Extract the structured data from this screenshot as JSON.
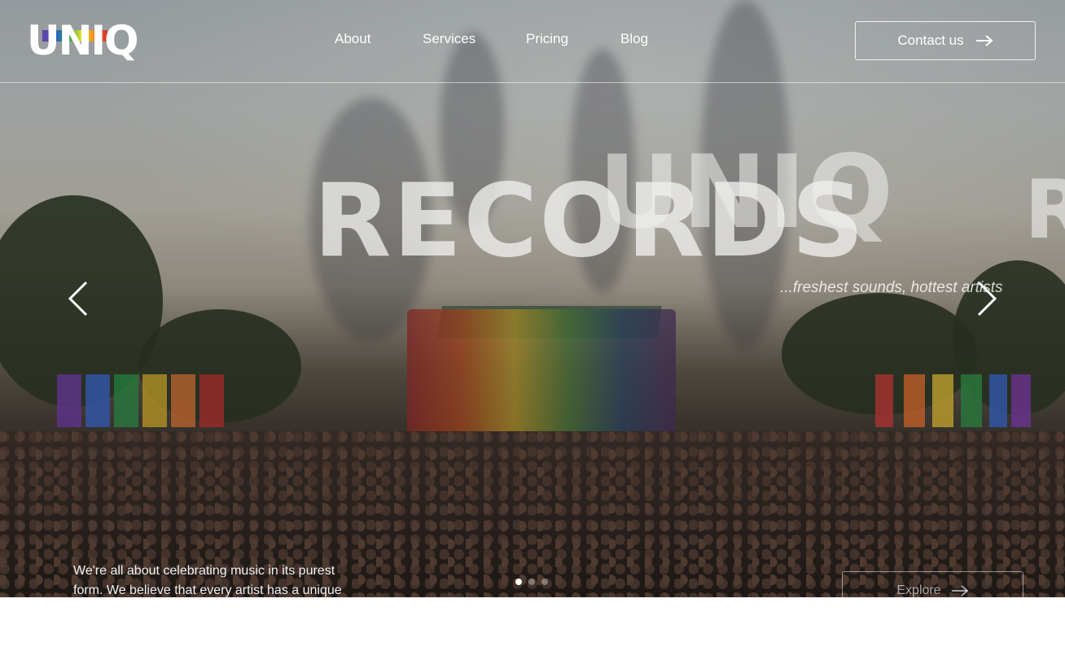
{
  "brand": {
    "logo_text": "UNIQ"
  },
  "nav": {
    "items": [
      {
        "label": "About"
      },
      {
        "label": "Services"
      },
      {
        "label": "Pricing"
      },
      {
        "label": "Blog"
      }
    ]
  },
  "header": {
    "contact_label": "Contact us"
  },
  "hero": {
    "word_primary": "RECORDS",
    "word_secondary": "UNIQ",
    "word_edge": "R",
    "tagline": "...freshest sounds, hottest artists",
    "intro_text": "We're all about celebrating music in its purest form. We believe that every artist has a unique",
    "explore_label": "Explore",
    "slides": {
      "total": 3,
      "active": 1
    }
  },
  "icons": {
    "contact_arrow": "arrow-right-icon",
    "explore_arrow": "arrow-right-icon",
    "prev": "chevron-left-icon",
    "next": "chevron-right-icon"
  },
  "colors": {
    "text": "#ffffff",
    "logo_gradient": [
      "#6b3fa0",
      "#2f5fd0",
      "#23a04a",
      "#e8e22a",
      "#f08a22",
      "#d92a2a"
    ]
  }
}
